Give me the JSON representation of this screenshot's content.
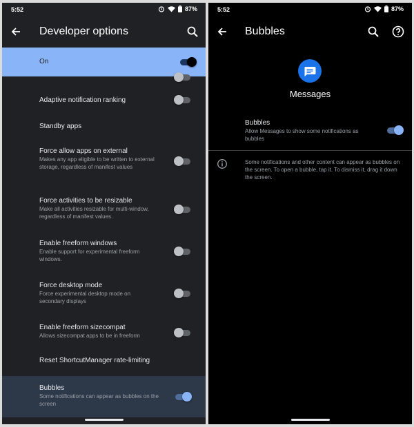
{
  "left": {
    "status": {
      "time": "5:52",
      "battery": "87%"
    },
    "title": "Developer options",
    "master": {
      "label": "On",
      "state": "on"
    },
    "rows": [
      {
        "title": "Adaptive notification ranking",
        "subtitle": ""
      },
      {
        "title": "Standby apps",
        "subtitle": ""
      },
      {
        "title": "Force allow apps on external",
        "subtitle": "Makes any app eligible to be written to external storage, regardless of manifest values"
      },
      {
        "title": "Force activities to be resizable",
        "subtitle": "Make all activities resizable for multi-window, regardless of manifest values."
      },
      {
        "title": "Enable freeform windows",
        "subtitle": "Enable support for experimental freeform windows."
      },
      {
        "title": "Force desktop mode",
        "subtitle": "Force experimental desktop mode on secondary displays"
      },
      {
        "title": "Enable freeform sizecompat",
        "subtitle": "Allows sizecompat apps to be in freeform"
      },
      {
        "title": "Reset ShortcutManager rate-limiting",
        "subtitle": ""
      },
      {
        "title": "Bubbles",
        "subtitle": "Some notifications can appear as bubbles on the screen",
        "state": "on"
      }
    ]
  },
  "right": {
    "status": {
      "time": "5:52",
      "battery": "87%"
    },
    "title": "Bubbles",
    "app_name": "Messages",
    "setting": {
      "title": "Bubbles",
      "subtitle": "Allow Messages to show some notifications as bubbles",
      "state": "on"
    },
    "info": "Some notifications and other content can appear as bubbles on the screen. To open a bubble, tap it. To dismiss it, drag it down the screen."
  },
  "colors": {
    "accent": "#8ab4f8",
    "app_icon": "#1a73e8",
    "selected_row": "#2d3849"
  }
}
